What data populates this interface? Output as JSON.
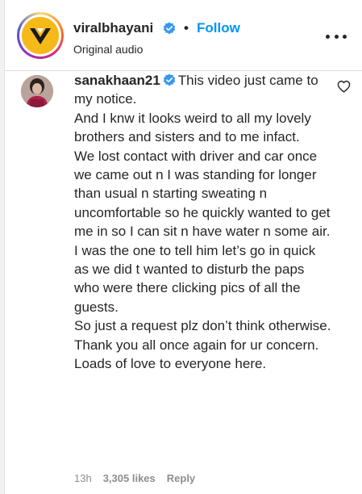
{
  "header": {
    "username": "viralbhayani",
    "separator": "•",
    "follow_label": "Follow",
    "subtitle": "Original audio",
    "verified_icon": "verified-badge-icon",
    "more_icon": "more-options-icon"
  },
  "comment": {
    "username": "sanakhaan21",
    "verified_icon": "verified-badge-icon",
    "text": "This video just came to my notice.\nAnd I knw it looks weird to all my lovely brothers and sisters and to me infact.\nWe lost contact with driver and car once we came out n I was standing for longer than usual n starting sweating n uncomfortable so he quickly wanted to get me in so I can sit n have water n some air.\nI was the one to tell him let’s go in quick as we did t wanted to disturb the paps who were there clicking pics of all the guests.\nSo just a request plz don’t think otherwise.\nThank you all once again for ur concern.\nLoads of love to everyone here.",
    "time": "13h",
    "likes": "3,305 likes",
    "reply_label": "Reply",
    "like_icon": "heart-icon"
  },
  "colors": {
    "accent": "#0095f6",
    "verified": "#3897f0",
    "logo_yellow": "#f6b91a"
  }
}
